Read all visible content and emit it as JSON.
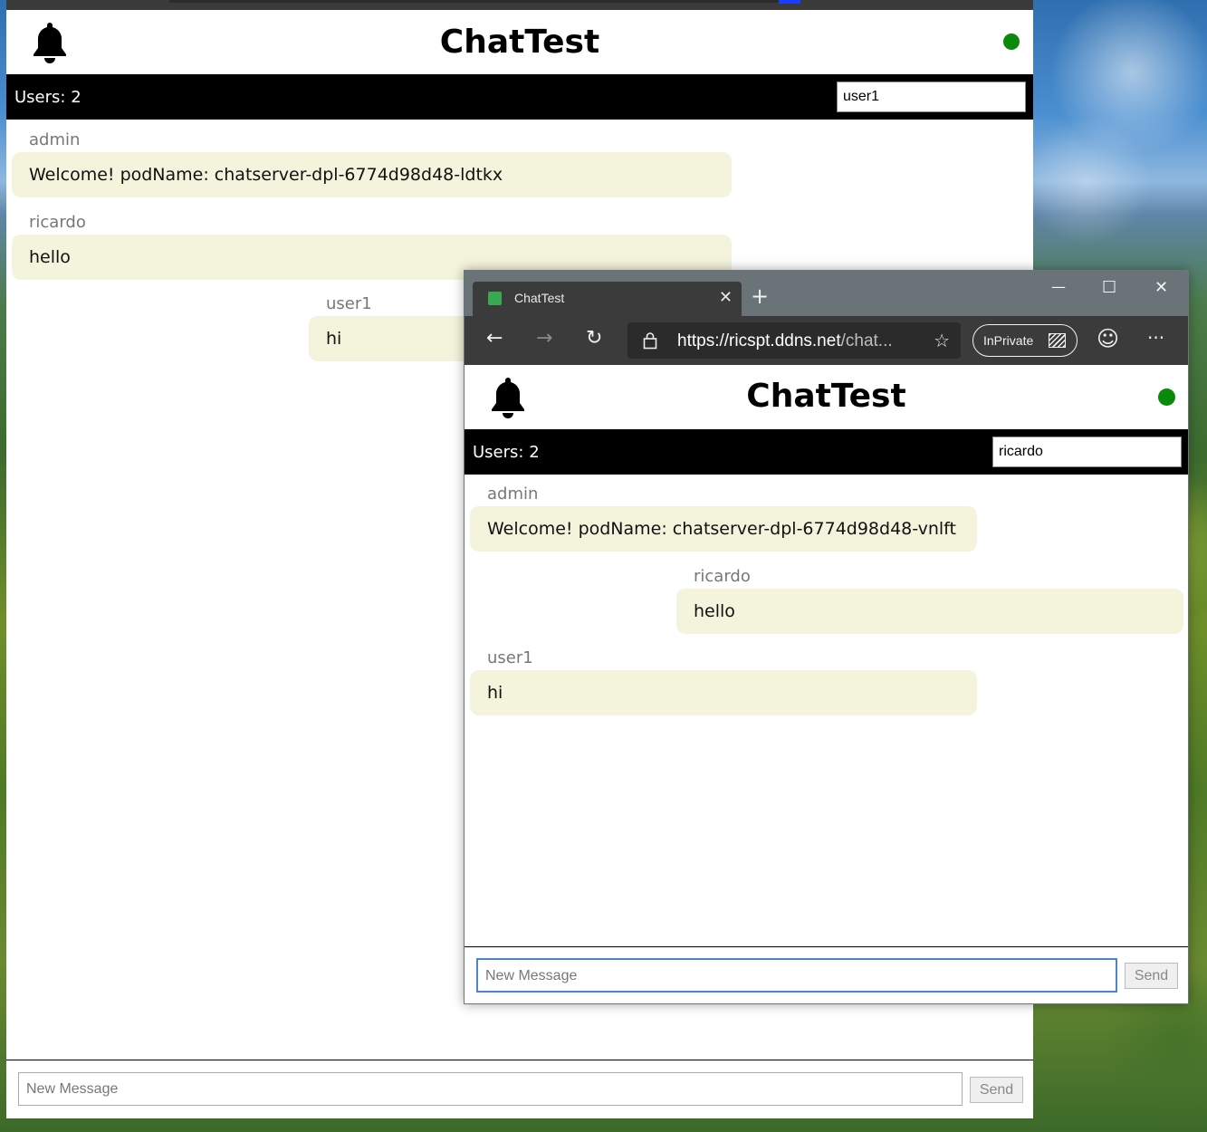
{
  "back_window": {
    "app_title": "ChatTest",
    "users_count_label": "Users: 2",
    "username_value": "user1",
    "messages": [
      {
        "author": "admin",
        "text": "Welcome! podName: chatserver-dpl-6774d98d48-ldtkx"
      },
      {
        "author": "ricardo",
        "text": "hello"
      },
      {
        "author": "user1",
        "text": "hi"
      }
    ],
    "composer": {
      "placeholder": "New Message",
      "send_label": "Send"
    }
  },
  "front_window": {
    "tab_title": "ChatTest",
    "tab_close": "✕",
    "new_tab": "+",
    "window_controls": {
      "minimize": "—",
      "maximize": "☐",
      "close": "✕"
    },
    "nav": {
      "back": "←",
      "forward": "→",
      "refresh": "↻"
    },
    "address": {
      "url_main": "https://ricspt.ddns.net",
      "url_rest": "/chat..."
    },
    "favorite_icon": "☆",
    "inprivate_label": "InPrivate",
    "emoji_icon": "☺",
    "more_icon": "···",
    "app_title": "ChatTest",
    "users_count_label": "Users: 2",
    "username_value": "ricardo",
    "messages": [
      {
        "author": "admin",
        "text": "Welcome! podName: chatserver-dpl-6774d98d48-vnlft"
      },
      {
        "author": "ricardo",
        "text": "hello"
      },
      {
        "author": "user1",
        "text": "hi"
      }
    ],
    "composer": {
      "placeholder": "New Message",
      "send_label": "Send"
    }
  },
  "colors": {
    "bubble": "#f4f3dc",
    "status_online": "#0a8a0a",
    "users_bar": "#000000",
    "browser_toolbar": "#3b3b3b",
    "tabstrip": "#6a7378"
  }
}
